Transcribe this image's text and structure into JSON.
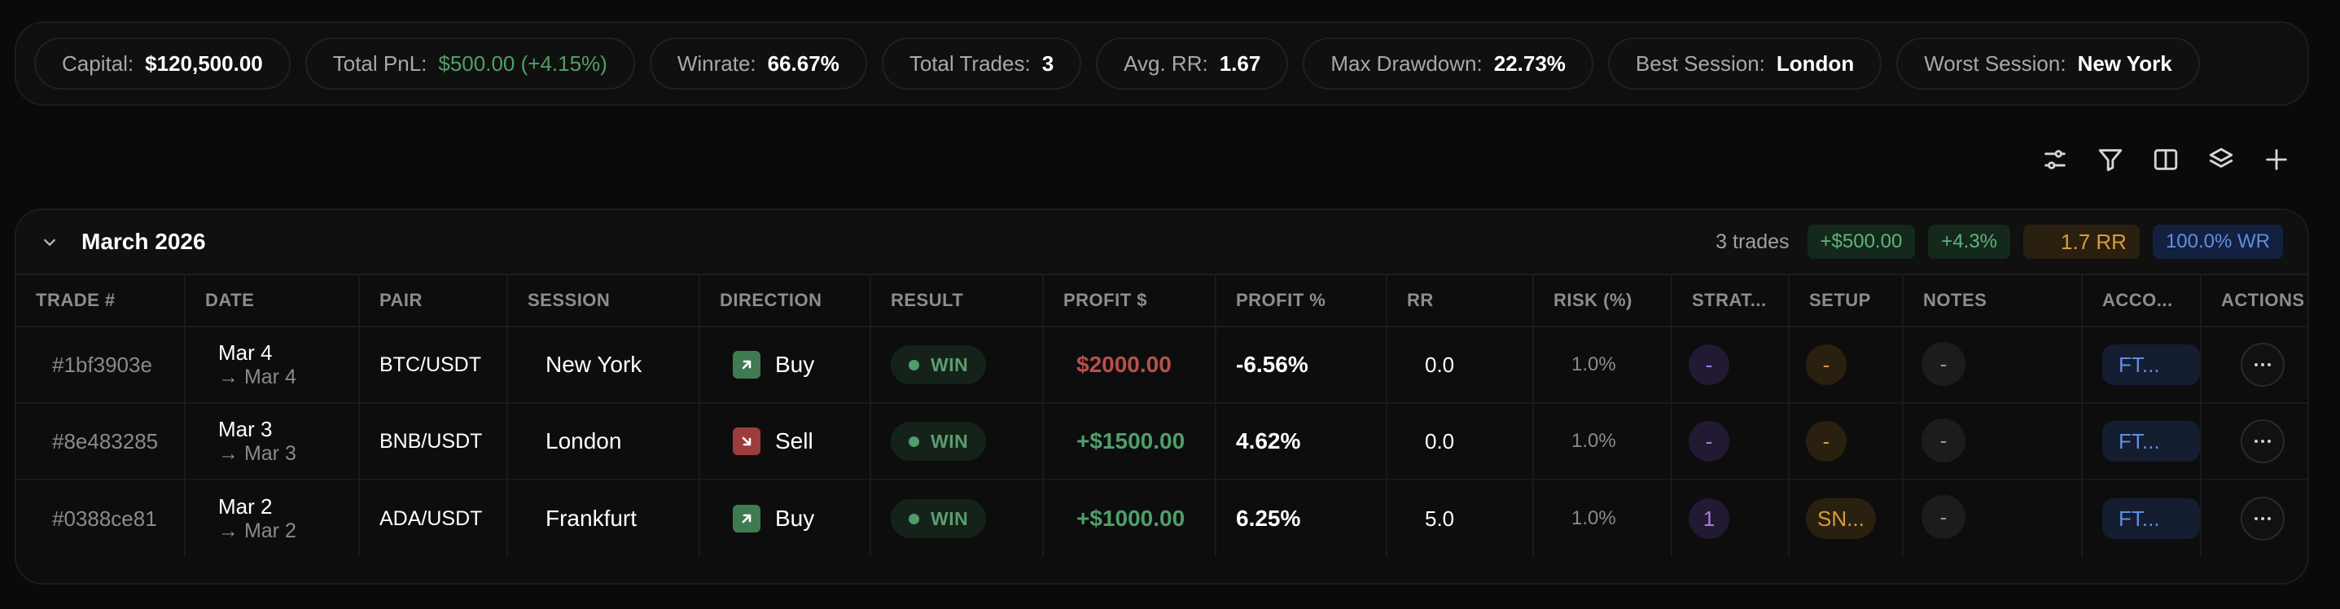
{
  "stats": [
    {
      "label": "Capital:",
      "value": "$120,500.00",
      "tone": "default"
    },
    {
      "label": "Total PnL:",
      "value": "$500.00 (+4.15%)",
      "tone": "pos"
    },
    {
      "label": "Winrate:",
      "value": "66.67%",
      "tone": "default"
    },
    {
      "label": "Total Trades:",
      "value": "3",
      "tone": "default"
    },
    {
      "label": "Avg. RR:",
      "value": "1.67",
      "tone": "default"
    },
    {
      "label": "Max Drawdown:",
      "value": "22.73%",
      "tone": "default"
    },
    {
      "label": "Best Session:",
      "value": "London",
      "tone": "default"
    },
    {
      "label": "Worst Session:",
      "value": "New York",
      "tone": "default"
    }
  ],
  "toolbar": {
    "icons": [
      "sliders-icon",
      "filter-icon",
      "columns-icon",
      "layers-icon",
      "plus-icon"
    ]
  },
  "group": {
    "title": "March 2026",
    "trade_count": "3 trades",
    "pnl": "+$500.00",
    "pct": "+4.3%",
    "rr": "1.7 RR",
    "wr": "100.0% WR"
  },
  "columns": [
    "TRADE #",
    "DATE",
    "PAIR",
    "SESSION",
    "DIRECTION",
    "RESULT",
    "PROFIT $",
    "PROFIT %",
    "RR",
    "RISK (%)",
    "STRAT...",
    "SETUP",
    "NOTES",
    "ACCO...",
    "ACTIONS"
  ],
  "trades": [
    {
      "id": "#1bf3903e",
      "date": "Mar 4",
      "date_to": "→ Mar 4",
      "pair": "BTC/USDT",
      "session": "New York",
      "direction": "Buy",
      "result": "WIN",
      "profit": "$2000.00",
      "profit_tone": "neg",
      "profit_pct": "-6.56%",
      "rr": "0.0",
      "risk": "1.0%",
      "strategy": "-",
      "setup": "-",
      "notes": "-",
      "account": "FT..."
    },
    {
      "id": "#8e483285",
      "date": "Mar 3",
      "date_to": "→ Mar 3",
      "pair": "BNB/USDT",
      "session": "London",
      "direction": "Sell",
      "result": "WIN",
      "profit": "+$1500.00",
      "profit_tone": "pos",
      "profit_pct": "4.62%",
      "rr": "0.0",
      "risk": "1.0%",
      "strategy": "-",
      "setup": "-",
      "notes": "-",
      "account": "FT..."
    },
    {
      "id": "#0388ce81",
      "date": "Mar 2",
      "date_to": "→ Mar 2",
      "pair": "ADA/USDT",
      "session": "Frankfurt",
      "direction": "Buy",
      "result": "WIN",
      "profit": "+$1000.00",
      "profit_tone": "pos",
      "profit_pct": "6.25%",
      "rr": "5.0",
      "risk": "1.0%",
      "strategy": "1",
      "setup": "SN...",
      "notes": "-",
      "account": "FT..."
    }
  ],
  "colors": {
    "positive": "#4f9e6a",
    "negative": "#b8504a",
    "buy": "#3f7a52",
    "sell": "#9c3c3c"
  }
}
